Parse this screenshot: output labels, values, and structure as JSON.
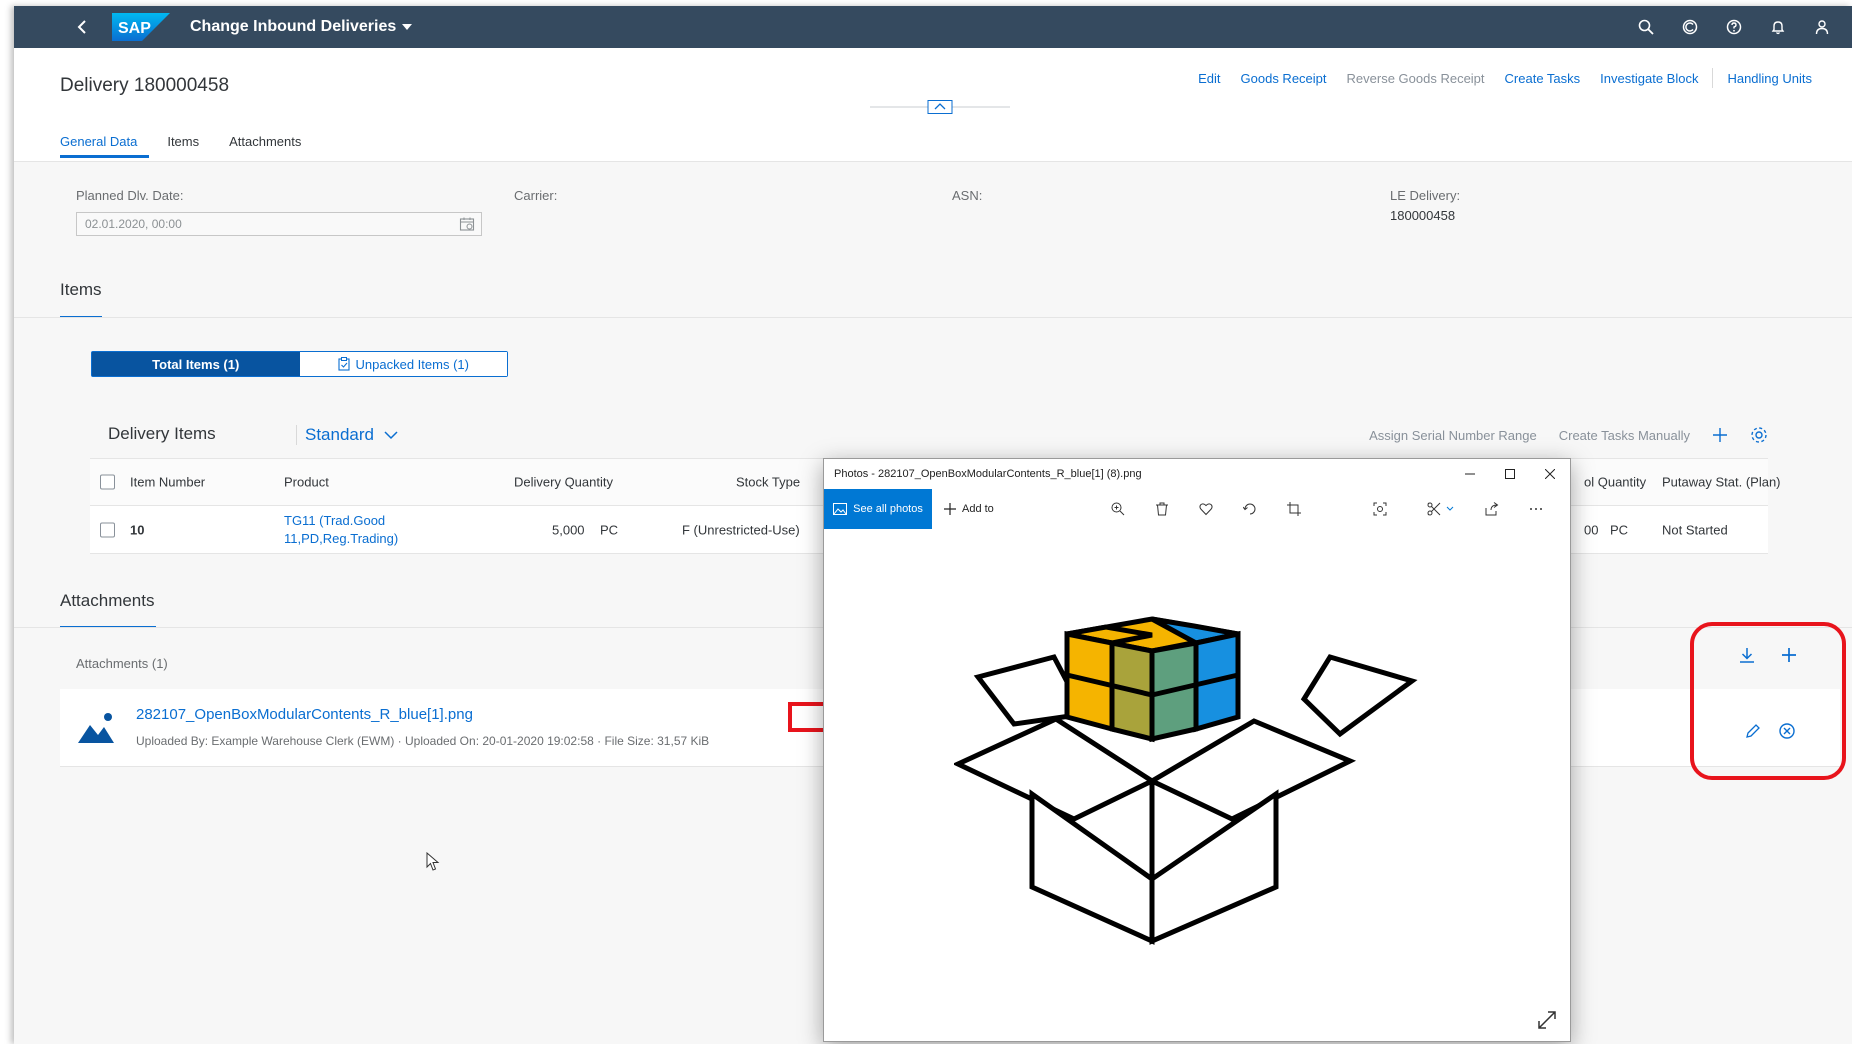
{
  "shell": {
    "app_title": "Change Inbound Deliveries",
    "logo_text": "SAP"
  },
  "header": {
    "title": "Delivery 180000458",
    "actions": {
      "edit": "Edit",
      "goods_receipt": "Goods Receipt",
      "reverse_goods_receipt": "Reverse Goods Receipt",
      "create_tasks": "Create Tasks",
      "investigate_block": "Investigate Block",
      "handling_units": "Handling Units"
    },
    "tabs": [
      "General Data",
      "Items",
      "Attachments"
    ]
  },
  "general": {
    "planned_label": "Planned Dlv. Date:",
    "planned_value": "02.01.2020, 00:00",
    "carrier_label": "Carrier:",
    "asn_label": "ASN:",
    "le_label": "LE Delivery:",
    "le_value": "180000458"
  },
  "items_section": {
    "title": "Items",
    "segments": {
      "total": "Total Items (1)",
      "unpacked": "Unpacked Items (1)"
    },
    "table_title": "Delivery Items",
    "variant": "Standard",
    "assign_serial": "Assign Serial Number Range",
    "create_tasks_manually": "Create Tasks Manually",
    "columns": {
      "item_number": "Item Number",
      "product": "Product",
      "delivery_quantity": "Delivery Quantity",
      "stock_type": "Stock Type",
      "quantity_partial": "ol Quantity",
      "putaway": "Putaway Stat. (Plan)"
    },
    "row": {
      "item_number": "10",
      "product_line1": "TG11 (Trad.Good",
      "product_line2": "11,PD,Reg.Trading)",
      "qty": "5,000",
      "qty_unit": "PC",
      "stock_type": "F (Unrestricted-Use)",
      "partial_qty": "00",
      "partial_unit": "PC",
      "putaway": "Not Started"
    }
  },
  "attachments": {
    "title": "Attachments",
    "count_label": "Attachments (1)",
    "file_name": "282107_OpenBoxModularContents_R_blue[1].png",
    "meta": "Uploaded By: Example Warehouse Clerk (EWM) · Uploaded On: 20-01-2020 19:02:58 · File Size: 31,57 KiB"
  },
  "photos": {
    "title": "Photos - 282107_OpenBoxModularContents_R_blue[1] (8).png",
    "see_all": "See all photos",
    "add_to": "Add to"
  },
  "colors": {
    "shell": "#354a5f",
    "accent": "#0a6ed1",
    "highlight": "#e8141c",
    "photos_accent": "#0078d4"
  }
}
